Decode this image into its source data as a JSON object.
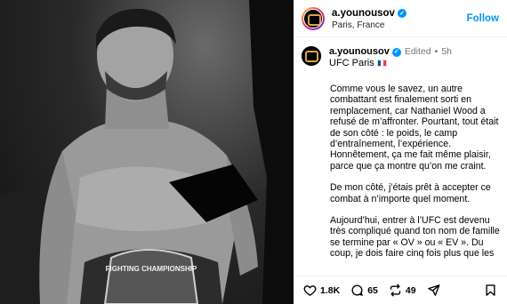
{
  "header": {
    "username": "a.younousov",
    "location": "Paris, France",
    "follow_label": "Follow"
  },
  "post": {
    "username": "a.younousov",
    "edited_label": "Edited",
    "separator": "•",
    "time": "5h",
    "title": "UFC Paris",
    "paragraphs": [
      "Comme vous le savez, un autre combattant est finalement sorti en remplacement, car Nathaniel Wood a refusé de m’affronter. Pourtant, tout était de son côté : le poids, le camp d’entraînement, l’expérience. Honnêtement, ça me fait même plaisir, parce que ça montre qu’on me craint.",
      "De mon côté, j’étais prêt à accepter ce combat à n’importe quel moment.",
      "Aujourd’hui, entrer à l’UFC est devenu très compliqué quand ton nom de famille se termine par « OV » ou « EV ». Du coup, je dois faire cinq fois plus que les"
    ]
  },
  "photo": {
    "belt_text": "FIGHTING CHAMPIONSHIP"
  },
  "actions": {
    "likes": "1.8K",
    "comments": "65",
    "shares": "49"
  }
}
